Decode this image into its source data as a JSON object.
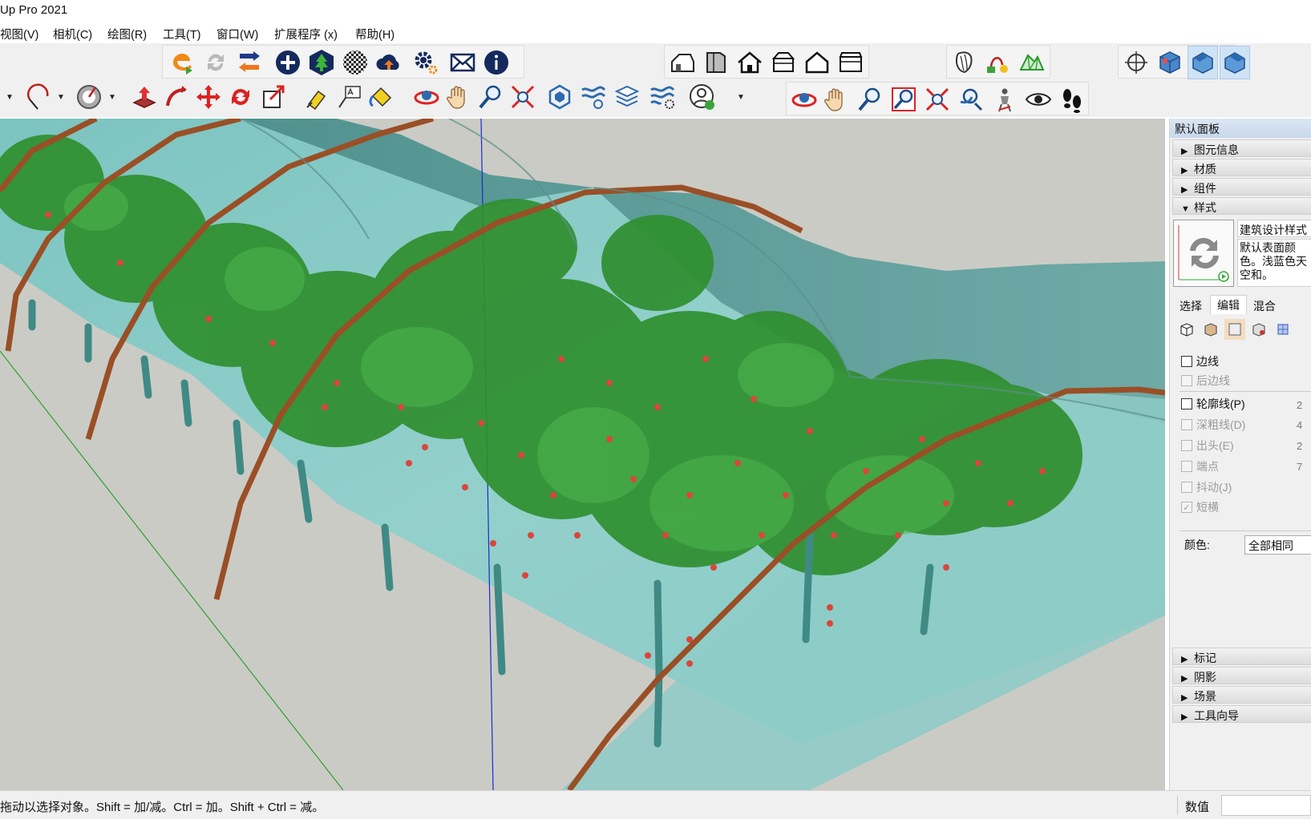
{
  "window": {
    "title": "Up Pro 2021"
  },
  "menu": [
    {
      "label": "视图(V)"
    },
    {
      "label": "相机(C)"
    },
    {
      "label": "绘图(R)"
    },
    {
      "label": "工具(T)"
    },
    {
      "label": "窗口(W)"
    },
    {
      "label": "扩展程序 (x)"
    },
    {
      "label": "帮助(H)"
    }
  ],
  "toolbar_top": {
    "groups": [
      "extensions",
      "model-info",
      "warehouse"
    ],
    "icons": [
      "extension-e-icon",
      "sync-icon",
      "transfer-icon",
      "add-circle-icon",
      "tree-icon",
      "checker-sphere-icon",
      "cloud-upload-icon",
      "gear-settings-icon",
      "mail-icon",
      "info-icon",
      "house-side-icon",
      "door-box-icon",
      "house-front-icon",
      "house-roof-icon",
      "house-outline-icon",
      "house-shop-icon",
      "sandbox-icon",
      "path-icon",
      "terrain-icon",
      "position-camera-icon",
      "iso-cube-icon",
      "view-right-icon",
      "view-back-icon"
    ]
  },
  "toolbar_bottom": {
    "icons": [
      "arc-icon",
      "protractor-icon",
      "push-pull-icon",
      "follow-me-icon",
      "move-icon",
      "rotate-icon",
      "scale-icon",
      "tape-measure-icon",
      "text-label-icon",
      "paint-bucket-icon",
      "orbit-icon",
      "pan-icon",
      "zoom-icon",
      "zoom-extents-icon",
      "component-icon",
      "layers-icon",
      "stack-icon",
      "settings-layers-icon",
      "user-icon",
      "orbit2-icon",
      "pan2-icon",
      "zoom2-icon",
      "zoom-window-icon",
      "zoom-extents2-icon",
      "previous-icon",
      "position-camera2-icon",
      "look-around-icon",
      "walk-icon"
    ]
  },
  "panel": {
    "tray_title": "默认面板",
    "sections_top": [
      {
        "label": "图元信息",
        "expanded": false
      },
      {
        "label": "材质",
        "expanded": false
      },
      {
        "label": "组件",
        "expanded": false
      },
      {
        "label": "样式",
        "expanded": true
      }
    ],
    "style": {
      "name": "建筑设计样式",
      "description": "默认表面颜色。浅蓝色天空和。"
    },
    "tabs": [
      {
        "label": "选择",
        "selected": false
      },
      {
        "label": "编辑",
        "selected": true
      },
      {
        "label": "混合",
        "selected": false
      }
    ],
    "edge_settings": [
      {
        "label": "边线",
        "checked": false,
        "enabled": true,
        "value": ""
      },
      {
        "label": "后边线",
        "checked": false,
        "enabled": false,
        "value": ""
      },
      {
        "label": "轮廓线(P)",
        "checked": false,
        "enabled": true,
        "value": "2"
      },
      {
        "label": "深粗线(D)",
        "checked": false,
        "enabled": false,
        "value": "4"
      },
      {
        "label": "出头(E)",
        "checked": false,
        "enabled": false,
        "value": "2"
      },
      {
        "label": "端点",
        "checked": false,
        "enabled": false,
        "value": "7"
      },
      {
        "label": "抖动(J)",
        "checked": false,
        "enabled": false,
        "value": ""
      },
      {
        "label": "短横",
        "checked": true,
        "enabled": false,
        "value": ""
      }
    ],
    "color_label": "颜色:",
    "color_value": "全部相同",
    "sections_bottom": [
      {
        "label": "标记"
      },
      {
        "label": "阴影"
      },
      {
        "label": "场景"
      },
      {
        "label": "工具向导"
      }
    ]
  },
  "status": {
    "hint": "拖动以选择对象。Shift = 加/减。Ctrl = 加。Shift + Ctrl = 减。",
    "measure_label": "数值",
    "measure_value": ""
  },
  "colors": {
    "sky": "#cbcbc5",
    "ground": "#cbcbc5",
    "greenhouse_film": "#8fd0cc",
    "arch": "#a0522d",
    "leaves": "#3a9a3a",
    "fruit": "#d9473a",
    "trunk": "#3f8a85"
  }
}
